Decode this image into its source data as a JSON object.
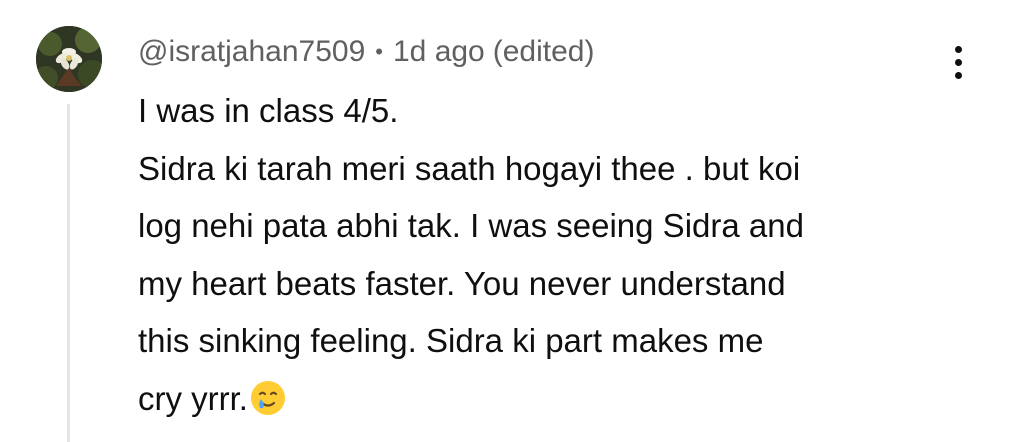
{
  "comment": {
    "author": "@isratjahan7509",
    "separator": "•",
    "time_ago": "1d ago",
    "edited": "(edited)",
    "body_lines": [
      "I was in class 4/5.",
      "Sidra ki tarah meri saath hogayi thee . but koi",
      "log nehi pata abhi tak. I was seeing Sidra and",
      "my heart beats faster. You never understand",
      "this sinking feeling. Sidra ki part makes me",
      "cry yrrr."
    ],
    "emoji": "smiling-face-with-tear"
  },
  "colors": {
    "meta_text": "#606060",
    "body_text": "#0f0f0f",
    "thread_line": "#e5e5e5"
  }
}
